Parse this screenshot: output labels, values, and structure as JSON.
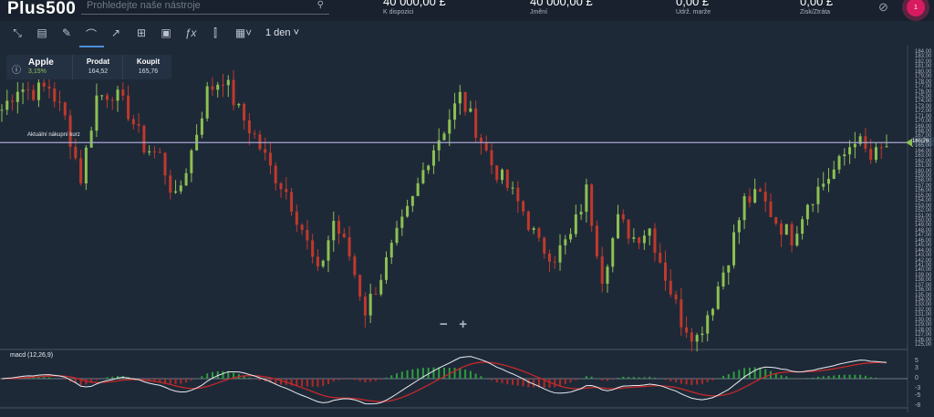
{
  "header": {
    "logo": "Plus500",
    "search_placeholder": "Prohledejte naše nástroje",
    "stats": [
      {
        "value": "40 000,00 £",
        "label": "K dispozici"
      },
      {
        "value": "40 000,00 £",
        "label": "Jmění"
      },
      {
        "value": "0,00 £",
        "label": "Udrž. marže"
      },
      {
        "value": "0,00 £",
        "label": "Zisk/Ztráta"
      }
    ],
    "notifications": "1"
  },
  "toolbar": {
    "period": "1 den",
    "icons": [
      "collapse-icon",
      "chat-icon",
      "pencil-icon",
      "indicator-icon",
      "trend-icon",
      "layout-icon",
      "save-icon",
      "function-icon",
      "candlestick-icon",
      "calendar-icon"
    ]
  },
  "instrument": {
    "name": "Apple",
    "change": "3,15%",
    "sell_label": "Prodat",
    "sell": "164,52",
    "buy_label": "Koupit",
    "buy": "165,76"
  },
  "chart_labels": {
    "buy_line": "Aktuální nákupní kurz",
    "current_price": "165,76",
    "macd": "macd (12,26,9)",
    "zoom_out": "−",
    "zoom_in": "+"
  },
  "colors": {
    "up": "#8cc152",
    "down": "#c0392b",
    "macd": "#e8ecf0",
    "signal": "#c62828",
    "line": "#a9a6d6"
  },
  "chart_data": {
    "type": "candlestick",
    "ylim": [
      125,
      184
    ],
    "current_price": 165.76,
    "yticks": [
      "184,00",
      "183,00",
      "182,00",
      "181,00",
      "180,00",
      "179,00",
      "178,00",
      "177,00",
      "176,00",
      "175,00",
      "174,00",
      "173,00",
      "172,00",
      "171,00",
      "170,00",
      "169,00",
      "168,00",
      "167,00",
      "166,00",
      "165,00",
      "164,00",
      "163,00",
      "162,00",
      "161,00",
      "160,00",
      "159,00",
      "158,00",
      "157,00",
      "156,00",
      "155,00",
      "154,00",
      "153,00",
      "152,00",
      "151,00",
      "150,00",
      "149,00",
      "148,00",
      "147,00",
      "146,00",
      "145,00",
      "144,00",
      "143,00",
      "142,00",
      "141,00",
      "140,00",
      "139,00",
      "138,00",
      "137,00",
      "136,00",
      "135,00",
      "134,00",
      "133,00",
      "132,00",
      "131,00",
      "130,00",
      "129,00",
      "128,00",
      "127,00",
      "126,00",
      "125,00"
    ],
    "macd_ticks": [
      "5",
      "3",
      "0",
      "-3",
      "-5",
      "-8"
    ],
    "closes": [
      172.4,
      177,
      176,
      177,
      170.6,
      158.6,
      175,
      176,
      172,
      165,
      163,
      154,
      164,
      176,
      179,
      172,
      167,
      160.5,
      156,
      148.5,
      139,
      150,
      143,
      132,
      139,
      146.7,
      154,
      163,
      168.7,
      175,
      168.7,
      161.4,
      156.8,
      152,
      145,
      143,
      146.7,
      156,
      139,
      150,
      146.7,
      148.5,
      139,
      130,
      126.5,
      133.8,
      143,
      154,
      155,
      150,
      146.7,
      154,
      157.7,
      161.4,
      167,
      162.3,
      165
    ]
  }
}
